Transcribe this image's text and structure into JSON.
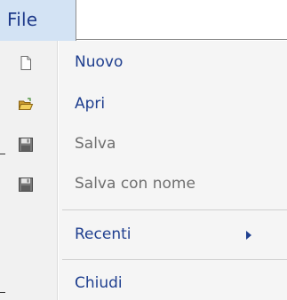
{
  "menubar": {
    "file_label": "File"
  },
  "menu": {
    "items": [
      {
        "label": "Nuovo",
        "icon": "new-document-icon",
        "enabled": true
      },
      {
        "label": "Apri",
        "icon": "open-folder-icon",
        "enabled": true
      },
      {
        "label": "Salva",
        "icon": "save-disk-icon",
        "enabled": false
      },
      {
        "label": "Salva con nome",
        "icon": "save-as-disk-icon",
        "enabled": false
      },
      {
        "label": "Recenti",
        "icon": "chevron-right-icon",
        "enabled": true,
        "submenu": true
      },
      {
        "label": "Chiudi",
        "enabled": true
      }
    ]
  },
  "colors": {
    "menu_text": "#1f3f8f",
    "disabled_text": "#6f6f6f",
    "file_highlight": "#d3e3f4"
  }
}
